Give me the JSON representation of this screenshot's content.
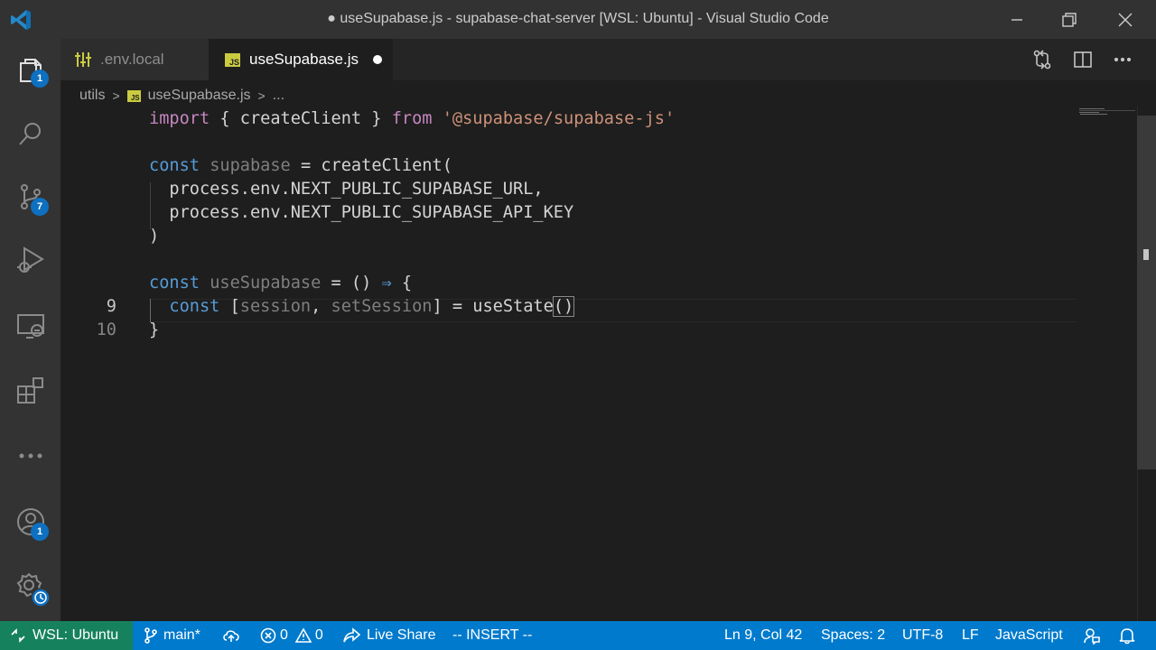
{
  "window": {
    "title": "● useSupabase.js - supabase-chat-server [WSL: Ubuntu] - Visual Studio Code"
  },
  "activity_bar": {
    "explorer_badge": "1",
    "source_control_badge": "7",
    "accounts_badge": "1"
  },
  "tabs": [
    {
      "label": ".env.local",
      "icon": "settings-file-icon",
      "active": false
    },
    {
      "label": "useSupabase.js",
      "icon": "js-icon",
      "icon_text": "JS",
      "active": true,
      "dirty": true
    }
  ],
  "breadcrumb": {
    "folder": "utils",
    "file": "useSupabase.js",
    "tail": "..."
  },
  "editor": {
    "current_line": 9,
    "lines": [
      {
        "number": "",
        "tokens": [
          {
            "t": "import",
            "c": "kc"
          },
          {
            "t": " { ",
            "c": "p"
          },
          {
            "t": "createClient",
            "c": "plain"
          },
          {
            "t": " } ",
            "c": "p"
          },
          {
            "t": "from",
            "c": "kc"
          },
          {
            "t": " ",
            "c": "p"
          },
          {
            "t": "'@supabase/supabase-js'",
            "c": "s"
          }
        ]
      },
      {
        "number": "",
        "tokens": []
      },
      {
        "number": "",
        "tokens": [
          {
            "t": "const",
            "c": "k"
          },
          {
            "t": " ",
            "c": "p"
          },
          {
            "t": "supabase",
            "c": "dim"
          },
          {
            "t": " = ",
            "c": "p"
          },
          {
            "t": "createClient",
            "c": "plain"
          },
          {
            "t": "(",
            "c": "p"
          }
        ]
      },
      {
        "number": "",
        "tokens": [
          {
            "t": "  process.env.NEXT_PUBLIC_SUPABASE_URL,",
            "c": "plain"
          }
        ]
      },
      {
        "number": "",
        "tokens": [
          {
            "t": "  process.env.NEXT_PUBLIC_SUPABASE_API_KEY",
            "c": "plain"
          }
        ]
      },
      {
        "number": "",
        "tokens": [
          {
            "t": ")",
            "c": "p"
          }
        ]
      },
      {
        "number": "",
        "tokens": []
      },
      {
        "number": "",
        "tokens": [
          {
            "t": "const",
            "c": "k"
          },
          {
            "t": " ",
            "c": "p"
          },
          {
            "t": "useSupabase",
            "c": "dim"
          },
          {
            "t": " = () ",
            "c": "p"
          },
          {
            "t": "⇒",
            "c": "k"
          },
          {
            "t": " {",
            "c": "p"
          }
        ]
      },
      {
        "number": "9",
        "tokens": [
          {
            "t": "  ",
            "c": "p"
          },
          {
            "t": "const",
            "c": "k"
          },
          {
            "t": " [",
            "c": "p"
          },
          {
            "t": "session",
            "c": "dim"
          },
          {
            "t": ", ",
            "c": "p"
          },
          {
            "t": "setSession",
            "c": "dim"
          },
          {
            "t": "] = ",
            "c": "p"
          },
          {
            "t": "useState",
            "c": "plain"
          },
          {
            "t": "()",
            "c": "p"
          }
        ]
      },
      {
        "number": "10",
        "tokens": [
          {
            "t": "}",
            "c": "p"
          }
        ]
      }
    ]
  },
  "status_bar": {
    "remote": "WSL: Ubuntu",
    "branch": "main*",
    "errors": "0",
    "warnings": "0",
    "live_share": "Live Share",
    "mode": "-- INSERT --",
    "position": "Ln 9, Col 42",
    "spaces": "Spaces: 2",
    "encoding": "UTF-8",
    "eol": "LF",
    "language": "JavaScript"
  },
  "colors": {
    "status_bar": "#007acc",
    "remote_indicator": "#16825d",
    "badge": "#0e70c0"
  }
}
